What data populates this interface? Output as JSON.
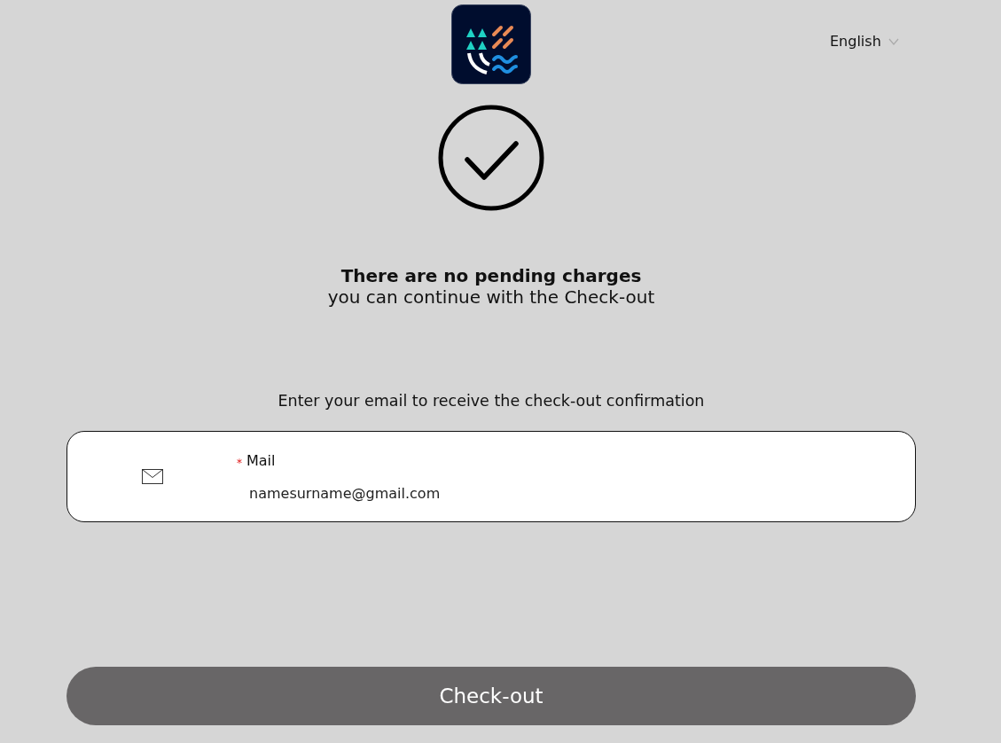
{
  "language": {
    "label": "English"
  },
  "status": {
    "title": "There are no pending charges",
    "subtitle": "you can continue with the Check-out"
  },
  "prompt": "Enter your email to receive the check-out confirmation",
  "email_field": {
    "required_mark": "⁎",
    "label": "Mail",
    "value": "namesurname@gmail.com"
  },
  "checkout_button": {
    "label": "Check-out",
    "disabled": true
  }
}
